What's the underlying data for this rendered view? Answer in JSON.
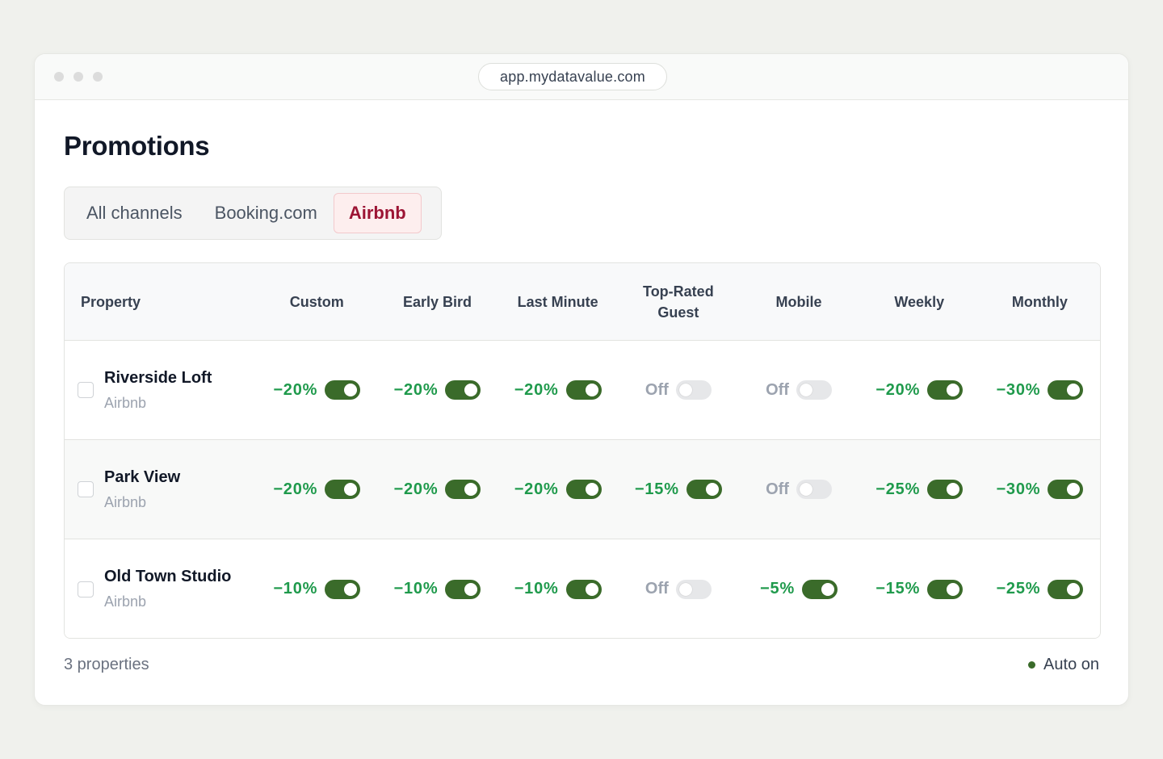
{
  "browser": {
    "url": "app.mydatavalue.com"
  },
  "page": {
    "title": "Promotions"
  },
  "tabs": [
    {
      "label": "All channels",
      "active": false
    },
    {
      "label": "Booking.com",
      "active": false
    },
    {
      "label": "Airbnb",
      "active": true
    }
  ],
  "table": {
    "headers": [
      "Property",
      "Custom",
      "Early Bird",
      "Last Minute",
      "Top-Rated Guest",
      "Mobile",
      "Weekly",
      "Monthly"
    ],
    "rows": [
      {
        "name": "Riverside Loft",
        "channel": "Airbnb",
        "cells": [
          {
            "value": "−20%",
            "on": true
          },
          {
            "value": "−20%",
            "on": true
          },
          {
            "value": "−20%",
            "on": true
          },
          {
            "value": "Off",
            "on": false
          },
          {
            "value": "Off",
            "on": false
          },
          {
            "value": "−20%",
            "on": true
          },
          {
            "value": "−30%",
            "on": true
          }
        ]
      },
      {
        "name": "Park View",
        "channel": "Airbnb",
        "cells": [
          {
            "value": "−20%",
            "on": true
          },
          {
            "value": "−20%",
            "on": true
          },
          {
            "value": "−20%",
            "on": true
          },
          {
            "value": "−15%",
            "on": true
          },
          {
            "value": "Off",
            "on": false
          },
          {
            "value": "−25%",
            "on": true
          },
          {
            "value": "−30%",
            "on": true
          }
        ]
      },
      {
        "name": "Old Town Studio",
        "channel": "Airbnb",
        "cells": [
          {
            "value": "−10%",
            "on": true
          },
          {
            "value": "−10%",
            "on": true
          },
          {
            "value": "−10%",
            "on": true
          },
          {
            "value": "Off",
            "on": false
          },
          {
            "value": "−5%",
            "on": true
          },
          {
            "value": "−15%",
            "on": true
          },
          {
            "value": "−25%",
            "on": true
          }
        ]
      }
    ]
  },
  "footer": {
    "count": "3 properties",
    "status": "Auto on"
  },
  "colors": {
    "accent": "#9c1434",
    "positive": "#1f9a4c",
    "toggle_on": "#3a6b2a"
  }
}
